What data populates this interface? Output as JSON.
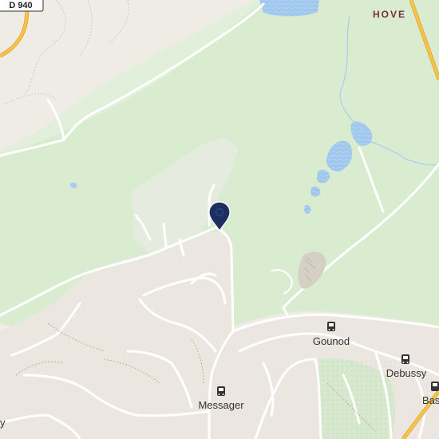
{
  "map": {
    "road_shield": "D 940",
    "place_label": "HOVE",
    "bus_stops": [
      {
        "label": "Gounod"
      },
      {
        "label": "Debussy"
      },
      {
        "label": "Messager"
      },
      {
        "label": "Bas"
      }
    ],
    "edge_fragment": "y",
    "marker": {
      "icon": "location-pin-icon",
      "color": "#1c2f5e"
    },
    "colors": {
      "forest": "#d9ecd0",
      "urban": "#ebe7e0",
      "water": "#a9cdef",
      "road": "#ffffff",
      "highway": "#f3c64a",
      "place_label": "#7a2e3a",
      "poi_text": "#333333"
    }
  }
}
